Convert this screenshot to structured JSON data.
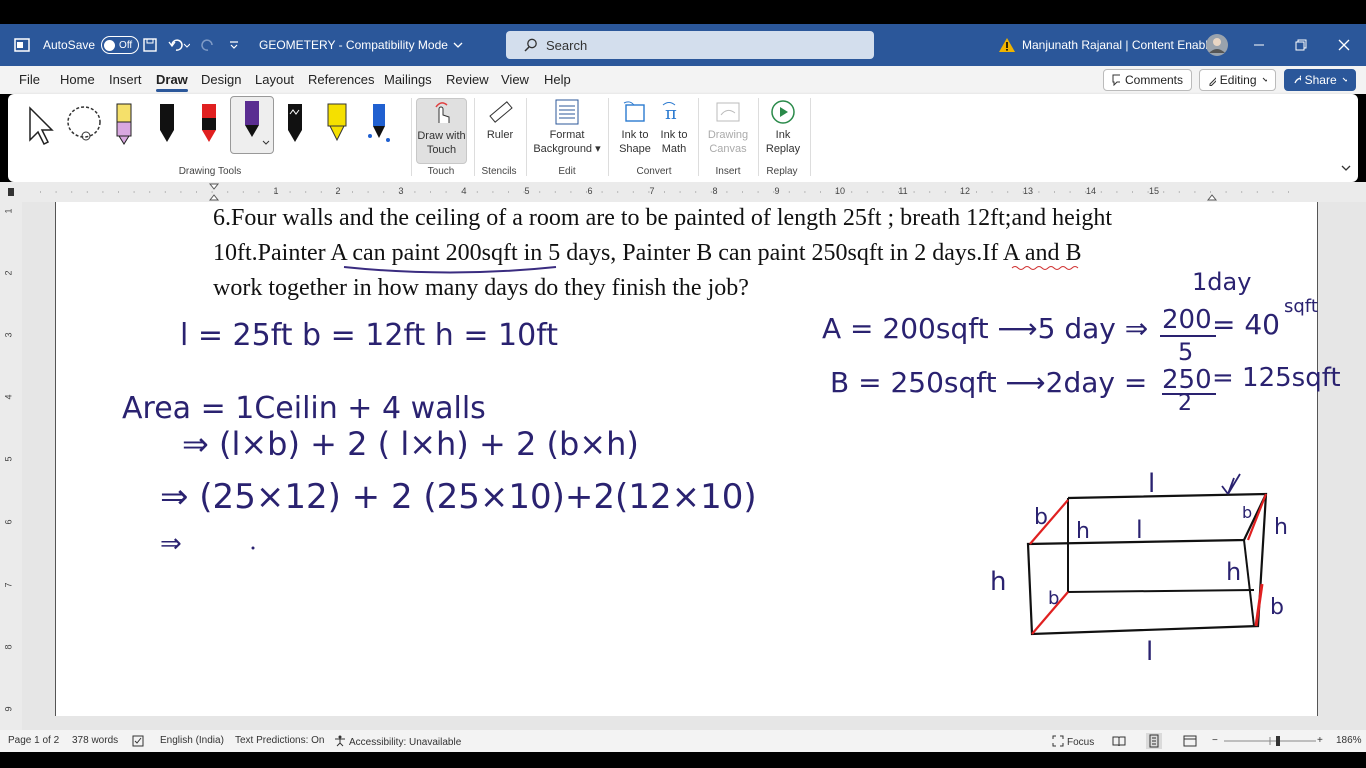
{
  "titlebar": {
    "autosave_label": "AutoSave",
    "autosave_state": "Off",
    "doc_title": "GEOMETERY  -  Compatibility Mode",
    "search_placeholder": "Search",
    "user_name": "Manjunath Rajanal | Content Enablers"
  },
  "menu": {
    "tabs": [
      "File",
      "Home",
      "Insert",
      "Draw",
      "Design",
      "Layout",
      "References",
      "Mailings",
      "Review",
      "View",
      "Help"
    ],
    "active_tab": "Draw",
    "comments": "Comments",
    "editing": "Editing",
    "share": "Share"
  },
  "ribbon": {
    "groups": {
      "drawing_tools": "Drawing Tools",
      "touch": "Touch",
      "stencils": "Stencils",
      "edit": "Edit",
      "convert": "Convert",
      "insert": "Insert",
      "replay": "Replay"
    },
    "buttons": {
      "draw_with_touch_1": "Draw with",
      "draw_with_touch_2": "Touch",
      "ruler": "Ruler",
      "format_bg_1": "Format",
      "format_bg_2": "Background",
      "ink_shape_1": "Ink to",
      "ink_shape_2": "Shape",
      "ink_math_1": "Ink to",
      "ink_math_2": "Math",
      "drawing_canvas_1": "Drawing",
      "drawing_canvas_2": "Canvas",
      "ink_replay_1": "Ink",
      "ink_replay_2": "Replay"
    },
    "pen_colors": [
      "#111111",
      "#e02020",
      "#5a2d91",
      "#111111",
      "#f5e000",
      "#2060d0"
    ]
  },
  "ruler": {
    "numbers": [
      "1",
      "2",
      "3",
      "4",
      "5",
      "6",
      "7",
      "8",
      "9",
      "10",
      "11",
      "12",
      "13",
      "14",
      "15"
    ],
    "vnumbers": [
      "1",
      "2",
      "3",
      "4",
      "5",
      "6",
      "7",
      "8",
      "9"
    ]
  },
  "document": {
    "line1": "6.Four walls and the ceiling of a room are to be painted of length 25ft ; breath 12ft;and height",
    "line2": "10ft.Painter A can paint 200sqft in 5 days, Painter B can paint 250sqft in 2 days.If A and B",
    "line3": "work together in how many days do they finish the job?"
  },
  "ink": {
    "dims": "l = 25ft    b = 12ft     h = 10ft",
    "area": "Area = 1Ceilin + 4 walls",
    "step1": "⇒  (l×b)  + 2 ( l×h) + 2 (b×h)",
    "step2": "⇒  (25×12) + 2 (25×10)+2(12×10)",
    "step3": "⇒",
    "oneday": "1day",
    "a_line": "A = 200sqft ⟶5 day ⇒",
    "a_num": "200",
    "a_den": "5",
    "a_res": "= 40",
    "a_unit": "sqft",
    "b_line": "B = 250sqft ⟶2day =",
    "b_num": "250",
    "b_den": "2",
    "b_res": "= 125sqft",
    "box_labels": [
      "l",
      "b",
      "h",
      "l",
      "b",
      "h",
      "h",
      "b",
      "h",
      "b",
      "l"
    ]
  },
  "status": {
    "page": "Page 1 of 2",
    "words": "378 words",
    "language": "English (India)",
    "predictions": "Text Predictions: On",
    "accessibility": "Accessibility: Unavailable",
    "focus": "Focus",
    "zoom": "186%"
  }
}
